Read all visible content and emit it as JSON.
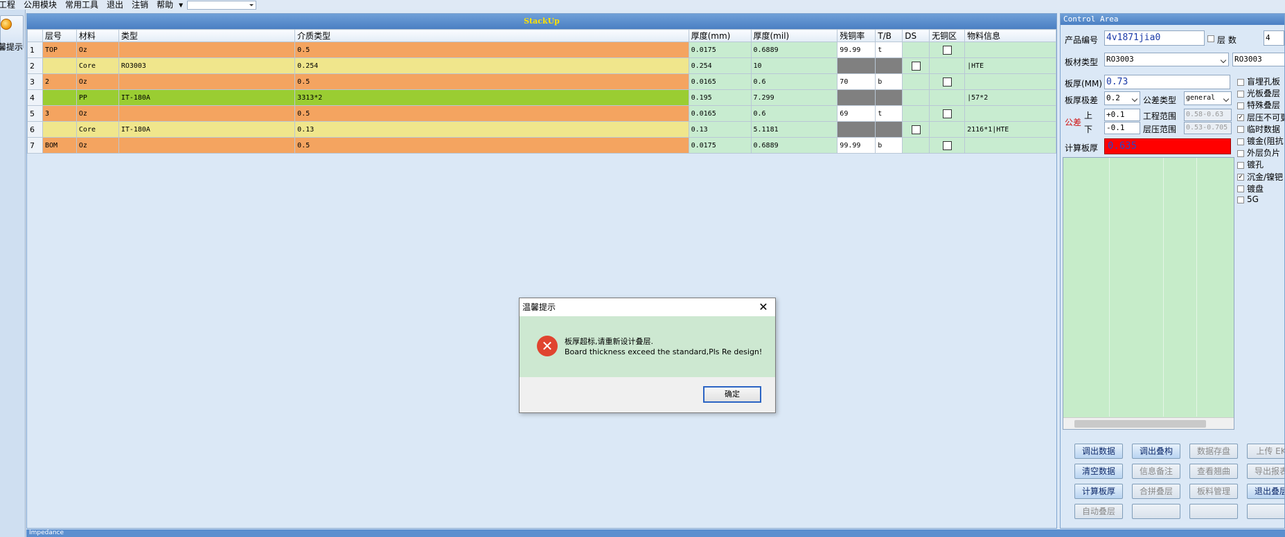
{
  "menu": {
    "items": [
      "工程",
      "公用模块",
      "常用工具",
      "退出",
      "注销",
      "帮助"
    ],
    "help_arrow": "▾",
    "combo_value": ""
  },
  "left": {
    "hint_label": "温馨提示",
    "icon": "orange-circle-icon"
  },
  "stackup": {
    "title": "StackUp",
    "columns": [
      "",
      "层号",
      "材料",
      "类型",
      "介质类型",
      "厚度(mm)",
      "厚度(mil)",
      "残铜率",
      "T/B",
      "DS",
      "无铜区",
      "物料信息"
    ],
    "rows": [
      {
        "n": "1",
        "layer": "TOP",
        "material": "Oz",
        "type": "",
        "dielectric": "0.5",
        "mm": "0.0175",
        "mil": "0.6889",
        "copper": "99.99",
        "tb": "t",
        "ds": "",
        "nocopper": "checkbox",
        "info": "",
        "style": "or"
      },
      {
        "n": "2",
        "layer": "",
        "material": "Core",
        "type": "RO3003",
        "dielectric": "0.254",
        "mm": "0.254",
        "mil": "10",
        "copper": "",
        "tb": "",
        "ds": "checkbox",
        "nocopper": "",
        "info": "|HTE",
        "style": "ye"
      },
      {
        "n": "3",
        "layer": "2",
        "material": "Oz",
        "type": "",
        "dielectric": "0.5",
        "mm": "0.0165",
        "mil": "0.6",
        "copper": "70",
        "tb": "b",
        "ds": "",
        "nocopper": "checkbox",
        "info": "",
        "style": "or"
      },
      {
        "n": "4",
        "layer": "",
        "material": "PP",
        "type": "IT-180A",
        "dielectric": "3313*2",
        "mm": "0.195",
        "mil": "7.299",
        "copper": "",
        "tb": "",
        "ds": "",
        "nocopper": "",
        "info": "|57*2",
        "style": "gr"
      },
      {
        "n": "5",
        "layer": "3",
        "material": "Oz",
        "type": "",
        "dielectric": "0.5",
        "mm": "0.0165",
        "mil": "0.6",
        "copper": "69",
        "tb": "t",
        "ds": "",
        "nocopper": "checkbox",
        "info": "",
        "style": "or"
      },
      {
        "n": "6",
        "layer": "",
        "material": "Core",
        "type": "IT-180A",
        "dielectric": "0.13",
        "mm": "0.13",
        "mil": "5.1181",
        "copper": "",
        "tb": "",
        "ds": "checkbox",
        "nocopper": "",
        "info": "2116*1|HTE",
        "style": "ye"
      },
      {
        "n": "7",
        "layer": "BOM",
        "material": "Oz",
        "type": "",
        "dielectric": "0.5",
        "mm": "0.0175",
        "mil": "0.6889",
        "copper": "99.99",
        "tb": "b",
        "ds": "",
        "nocopper": "checkbox",
        "info": "",
        "style": "or"
      }
    ]
  },
  "control": {
    "title": "Control Area",
    "product_label": "产品编号",
    "product_value": "4v1871jia0",
    "layers_label": "层 数",
    "layers_value": "4",
    "board_type_label": "板材类型",
    "board_type_value": "RO3003",
    "board_type_value2": "RO3003",
    "thickness_label": "板厚(MM)",
    "thickness_value": "0.73",
    "tolerance_grade_label": "板厚极差",
    "tolerance_grade_value": "0.2",
    "tolerance_type_label": "公差类型",
    "tolerance_type_value": "general",
    "tolerance_label": "公差",
    "upper_label": "上",
    "lower_label": "下",
    "upper_value": "+0.1",
    "lower_value": "-0.1",
    "eng_range_label": "工程范围",
    "eng_range_value": "0.58-0.63",
    "press_range_label": "层压范围",
    "press_range_value": "0.53-0.705",
    "calc_label": "计算板厚",
    "calc_value": "0.635",
    "options": [
      {
        "label": "盲埋孔板",
        "checked": false
      },
      {
        "label": "光板叠层",
        "checked": false
      },
      {
        "label": "特殊叠层",
        "checked": false
      },
      {
        "label": "层压不可更",
        "checked": true
      },
      {
        "label": "临时数据",
        "checked": false
      },
      {
        "label": "镀金(阻抗",
        "checked": false
      },
      {
        "label": "外层负片",
        "checked": false
      },
      {
        "label": "镀孔",
        "checked": false
      },
      {
        "label": "沉金/镍钯",
        "checked": true
      },
      {
        "label": "镀盘",
        "checked": false
      },
      {
        "label": "5G",
        "checked": false
      }
    ],
    "buttons": [
      {
        "label": "调出数据",
        "enabled": true
      },
      {
        "label": "调出叠构",
        "enabled": true
      },
      {
        "label": "数据存盘",
        "enabled": false
      },
      {
        "label": "上传 EK",
        "enabled": false
      },
      {
        "label": "清空数据",
        "enabled": true
      },
      {
        "label": "信息备注",
        "enabled": false
      },
      {
        "label": "查看翘曲",
        "enabled": false
      },
      {
        "label": "导出报表",
        "enabled": false
      },
      {
        "label": "计算板厚",
        "enabled": true
      },
      {
        "label": "合拼叠层",
        "enabled": false
      },
      {
        "label": "板料管理",
        "enabled": false
      },
      {
        "label": "退出叠层",
        "enabled": true
      },
      {
        "label": "自动叠层",
        "enabled": false
      },
      {
        "label": "",
        "enabled": false
      },
      {
        "label": "",
        "enabled": false
      },
      {
        "label": "",
        "enabled": false
      }
    ]
  },
  "bottom": {
    "label": "Impedance"
  },
  "dialog": {
    "title": "温馨提示",
    "close": "✕",
    "icon": "error-x-icon",
    "message_cn": "板厚超标,请重新设计叠层.",
    "message_en": "Board thickness exceed the standard,Pls Re design!",
    "ok": "确定"
  },
  "colors": {
    "outer_layer": "#f4a460",
    "core": "#f0e68c",
    "prepreg": "#9acd32",
    "calc_bg": "#ff0000",
    "dialog_body": "#cde8d1"
  }
}
